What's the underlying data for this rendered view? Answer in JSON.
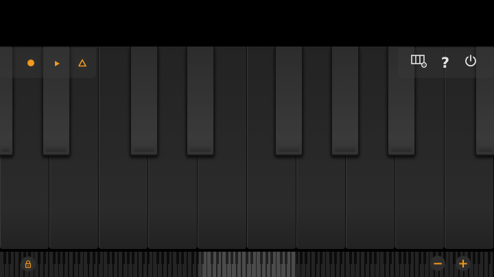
{
  "app": {
    "accent_color": "#f29a1c",
    "icon_color": "#e6e6e6",
    "background": "#000000"
  },
  "toolbar_left": [
    {
      "name": "record-button",
      "icon": "record-dot-icon"
    },
    {
      "name": "play-button",
      "icon": "play-triangle-icon"
    },
    {
      "name": "metronome-button",
      "icon": "metronome-triangle-icon"
    }
  ],
  "toolbar_right": [
    {
      "name": "keyboard-settings-button",
      "icon": "keyboard-gear-icon"
    },
    {
      "name": "help-button",
      "icon": "question-mark-icon",
      "glyph": "?"
    },
    {
      "name": "power-button",
      "icon": "power-icon"
    }
  ],
  "bottom_bar": {
    "lock": {
      "icon": "lock-icon"
    },
    "zoom_out": {
      "icon": "minus-icon",
      "glyph": "−"
    },
    "zoom_in": {
      "icon": "plus-icon",
      "glyph": "+"
    }
  },
  "keyboard": {
    "visible_white_keys": 10
  }
}
